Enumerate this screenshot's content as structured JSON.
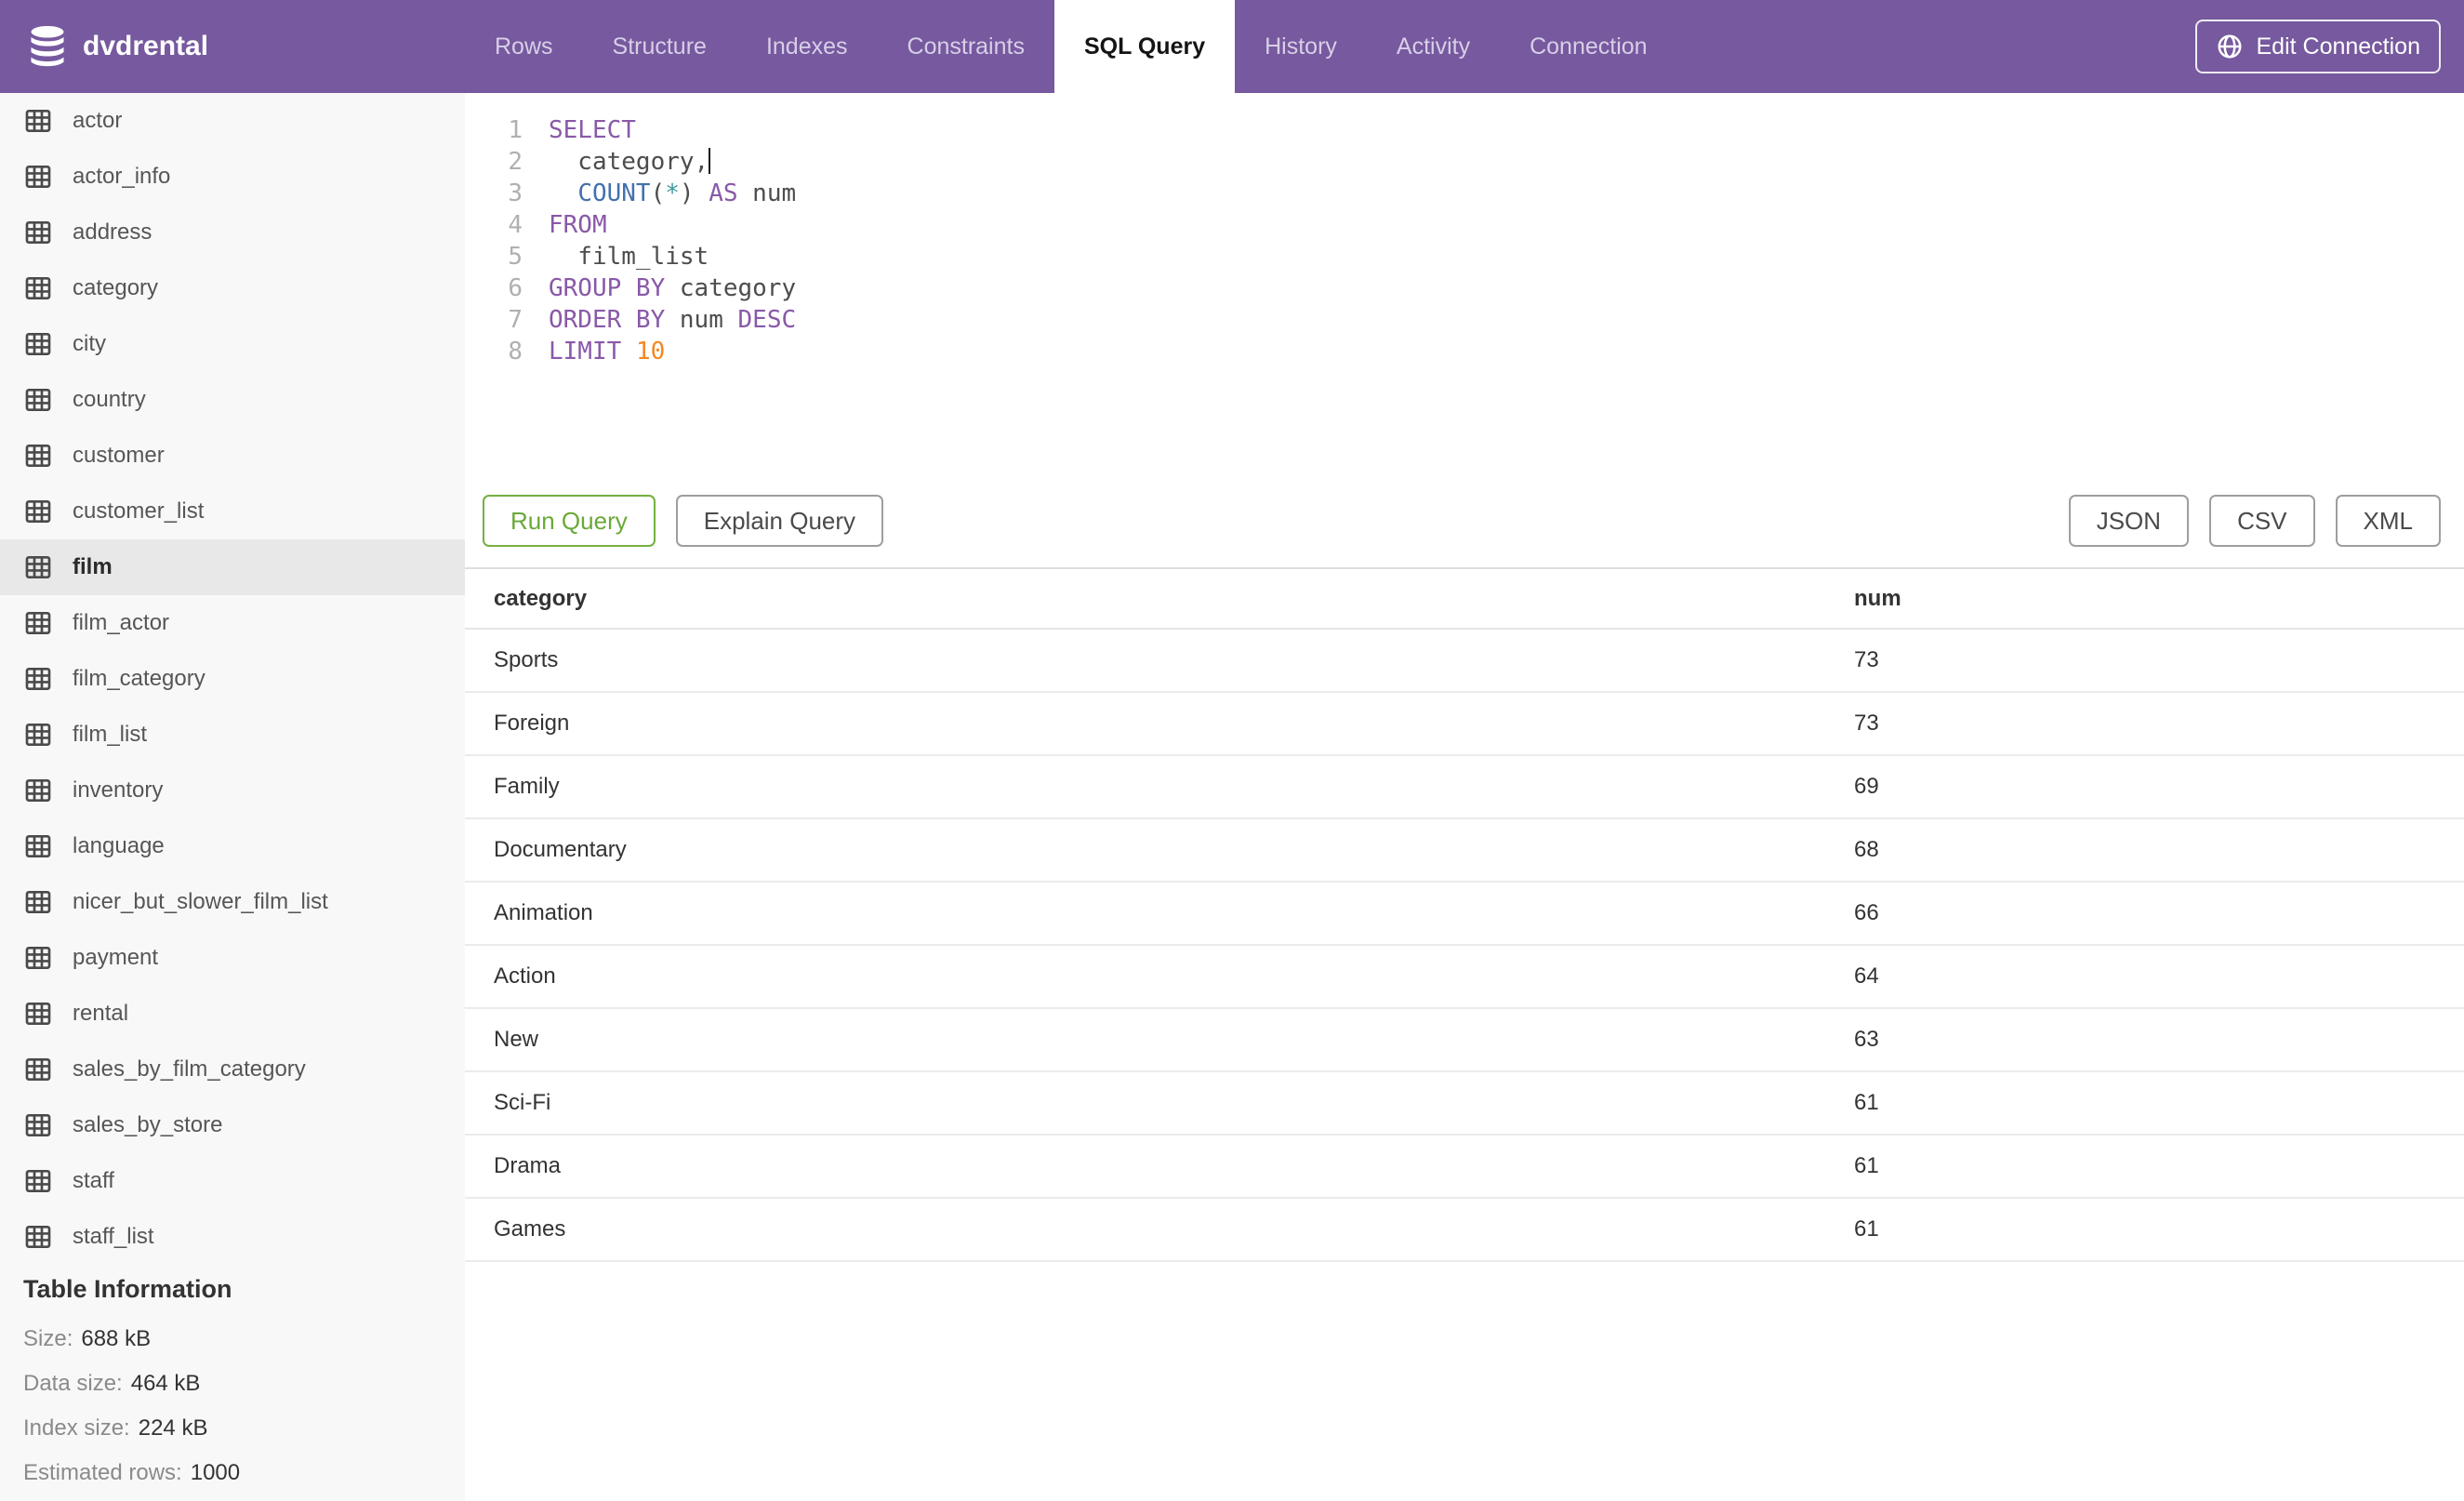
{
  "header": {
    "brand": "dvdrental",
    "brand_icon": "database-icon",
    "tabs": [
      {
        "label": "Rows",
        "active": false
      },
      {
        "label": "Structure",
        "active": false
      },
      {
        "label": "Indexes",
        "active": false
      },
      {
        "label": "Constraints",
        "active": false
      },
      {
        "label": "SQL Query",
        "active": true
      },
      {
        "label": "History",
        "active": false
      },
      {
        "label": "Activity",
        "active": false
      },
      {
        "label": "Connection",
        "active": false
      }
    ],
    "edit_connection": {
      "label": "Edit Connection",
      "icon": "globe-icon"
    }
  },
  "colors": {
    "header_purple": "#76599E",
    "active_tab_bg": "#FFFFFF",
    "run_green": "#74B042",
    "selected_row_bg": "#E8E8E8",
    "syntax_keyword": "#8959A8",
    "syntax_function": "#4271AE",
    "syntax_operator": "#3E999F",
    "syntax_number": "#F5871F",
    "syntax_identifier": "#4D4D4C"
  },
  "sidebar": {
    "table_icon": "table-grid-icon",
    "tables": [
      "actor",
      "actor_info",
      "address",
      "category",
      "city",
      "country",
      "customer",
      "customer_list",
      "film",
      "film_actor",
      "film_category",
      "film_list",
      "inventory",
      "language",
      "nicer_but_slower_film_list",
      "payment",
      "rental",
      "sales_by_film_category",
      "sales_by_store",
      "staff",
      "staff_list"
    ],
    "selected": "film",
    "table_info": {
      "heading": "Table Information",
      "rows": [
        {
          "label": "Size:",
          "value": "688 kB"
        },
        {
          "label": "Data size:",
          "value": "464 kB"
        },
        {
          "label": "Index size:",
          "value": "224 kB"
        },
        {
          "label": "Estimated rows:",
          "value": "1000"
        }
      ]
    }
  },
  "editor": {
    "lines": [
      {
        "n": "1",
        "tokens": [
          [
            "kw",
            "SELECT"
          ]
        ],
        "cursor": false
      },
      {
        "n": "2",
        "tokens": [
          [
            "id",
            "  category,"
          ]
        ],
        "cursor": true
      },
      {
        "n": "3",
        "tokens": [
          [
            "id",
            "  "
          ],
          [
            "fn",
            "COUNT"
          ],
          [
            "id",
            "("
          ],
          [
            "op",
            "*"
          ],
          [
            "id",
            ") "
          ],
          [
            "kw",
            "AS"
          ],
          [
            "id",
            " num"
          ]
        ],
        "cursor": false
      },
      {
        "n": "4",
        "tokens": [
          [
            "kw",
            "FROM"
          ]
        ],
        "cursor": false
      },
      {
        "n": "5",
        "tokens": [
          [
            "id",
            "  film_list"
          ]
        ],
        "cursor": false
      },
      {
        "n": "6",
        "tokens": [
          [
            "kw",
            "GROUP BY"
          ],
          [
            "id",
            " category"
          ]
        ],
        "cursor": false
      },
      {
        "n": "7",
        "tokens": [
          [
            "kw",
            "ORDER BY"
          ],
          [
            "id",
            " num "
          ],
          [
            "kw",
            "DESC"
          ]
        ],
        "cursor": false
      },
      {
        "n": "8",
        "tokens": [
          [
            "kw",
            "LIMIT"
          ],
          [
            "id",
            " "
          ],
          [
            "num",
            "10"
          ]
        ],
        "cursor": false
      }
    ]
  },
  "toolbar": {
    "run_label": "Run Query",
    "explain_label": "Explain Query",
    "export_buttons": [
      "JSON",
      "CSV",
      "XML"
    ]
  },
  "results": {
    "columns": [
      "category",
      "num"
    ],
    "rows": [
      [
        "Sports",
        "73"
      ],
      [
        "Foreign",
        "73"
      ],
      [
        "Family",
        "69"
      ],
      [
        "Documentary",
        "68"
      ],
      [
        "Animation",
        "66"
      ],
      [
        "Action",
        "64"
      ],
      [
        "New",
        "63"
      ],
      [
        "Sci-Fi",
        "61"
      ],
      [
        "Drama",
        "61"
      ],
      [
        "Games",
        "61"
      ]
    ]
  }
}
